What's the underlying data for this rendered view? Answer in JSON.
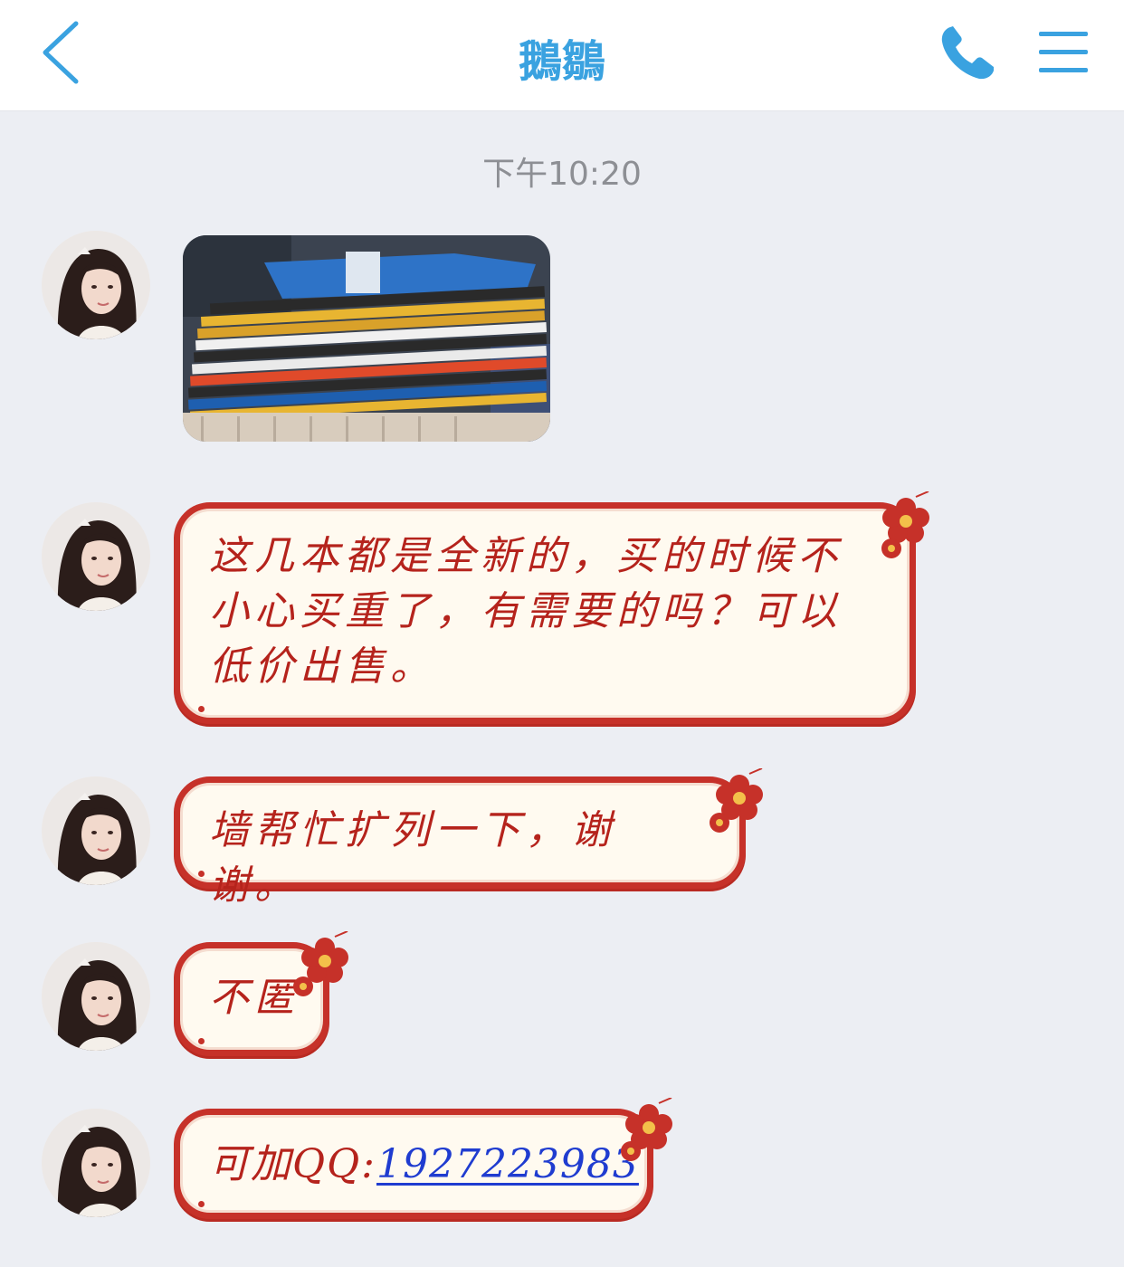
{
  "header": {
    "title": "鵝鶵",
    "back_icon": "chevron-left-icon",
    "call_icon": "phone-icon",
    "menu_icon": "hamburger-menu-icon",
    "accent_color": "#3aa2e0"
  },
  "chat": {
    "timestamp": "下午10:20",
    "messages": [
      {
        "type": "image",
        "description_icon": "photo-of-books"
      },
      {
        "type": "text",
        "text": "这几本都是全新的，买的时候不小心买重了，有需要的吗？可以低价出售。"
      },
      {
        "type": "text",
        "text": "墙帮忙扩列一下，谢谢。"
      },
      {
        "type": "text",
        "text": "不匿"
      },
      {
        "type": "text",
        "prefix": "可加QQ:",
        "link": "1927223983"
      }
    ]
  },
  "colors": {
    "bubble_border": "#c63129",
    "bubble_fill": "#fffaf0",
    "bubble_text": "#b5231c",
    "link": "#1f3cd0",
    "background": "#eceef3"
  }
}
